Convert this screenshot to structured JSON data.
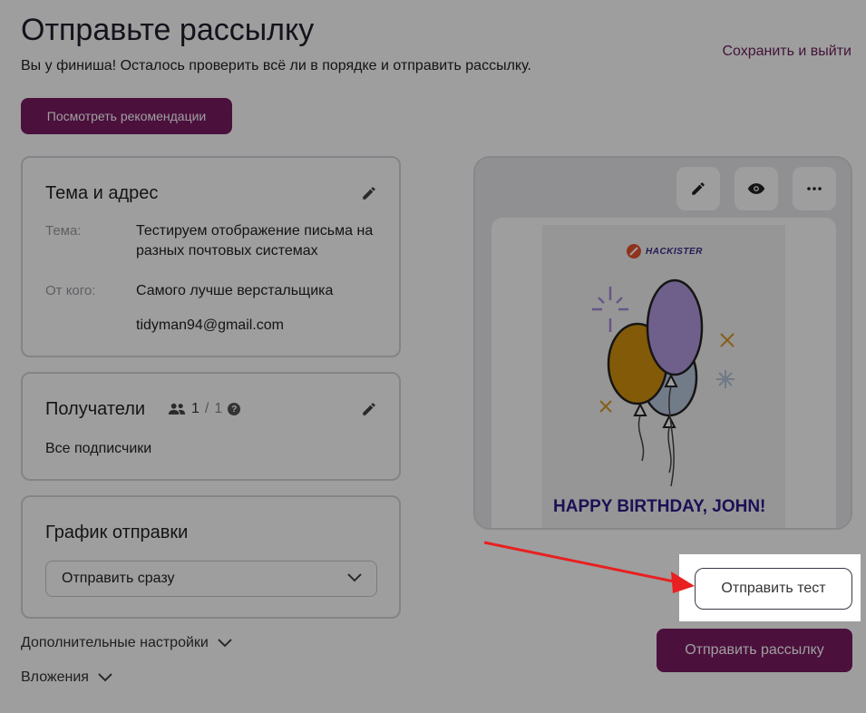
{
  "header": {
    "title": "Отправьте рассылку",
    "subtitle": "Вы у финиша! Осталось проверить всё ли в порядке и отправить рассылку.",
    "save_exit": "Сохранить и выйти",
    "recommendations_button": "Посмотреть рекомендации"
  },
  "subject_card": {
    "title": "Тема и адрес",
    "subject_label": "Тема:",
    "subject_value": "Тестируем отображение письма на разных почтовых системах",
    "from_label": "От кого:",
    "from_name": "Самого лучше верстальщика",
    "from_email": "tidyman94@gmail.com",
    "edit_icon": "pencil-icon"
  },
  "recipients_card": {
    "title": "Получатели",
    "count": "1",
    "total": "1",
    "help": "?",
    "list": "Все подписчики",
    "people_icon": "people-icon",
    "edit_icon": "pencil-icon"
  },
  "schedule_card": {
    "title": "График отправки",
    "selected": "Отправить сразу"
  },
  "extra": {
    "additional_settings": "Дополнительные настройки",
    "attachments": "Вложения"
  },
  "preview": {
    "logo_text": "HACKISTER",
    "headline": "HAPPY BIRTHDAY, JOHN!",
    "tools": [
      "pencil-icon",
      "eye-icon",
      "more-icon"
    ]
  },
  "actions": {
    "send_test": "Отправить тест",
    "send_campaign": "Отправить рассылку"
  },
  "colors": {
    "brand": "#7b1a63",
    "arrow": "#e82020"
  }
}
